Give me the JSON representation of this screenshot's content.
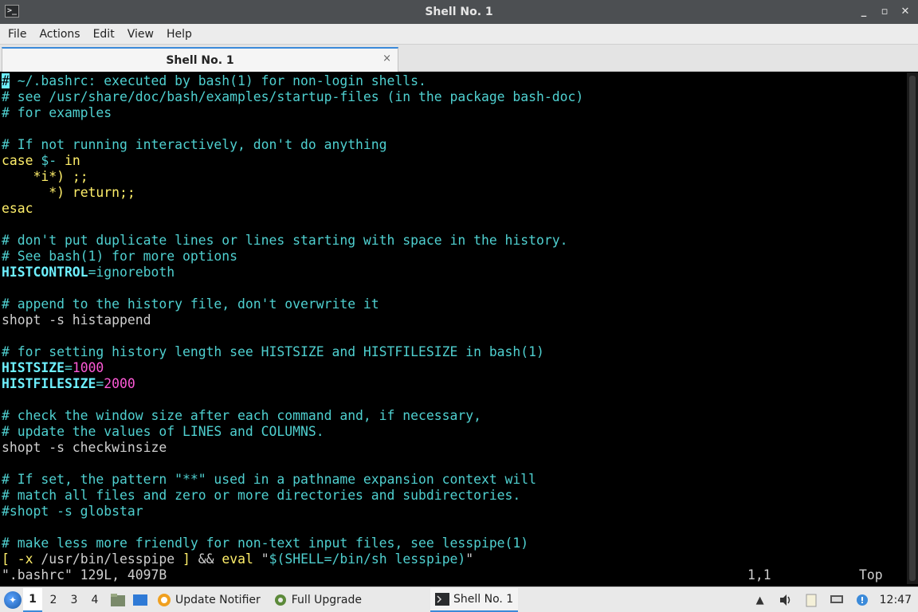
{
  "window": {
    "title": "Shell No. 1",
    "controls": {
      "minimize": "_",
      "maximize": "▫",
      "close": "✕"
    }
  },
  "menu": [
    "File",
    "Actions",
    "Edit",
    "View",
    "Help"
  ],
  "tab": {
    "label": "Shell No. 1",
    "close": "×"
  },
  "terminal": {
    "lines": [
      [
        [
          "cursor",
          "#"
        ],
        [
          "c",
          " ~/.bashrc: executed by bash(1) for non-login shells."
        ]
      ],
      [
        [
          "c",
          "# see /usr/share/doc/bash/examples/startup-files (in the package bash-doc)"
        ]
      ],
      [
        [
          "c",
          "# for examples"
        ]
      ],
      [],
      [
        [
          "c",
          "# If not running interactively, don't do anything"
        ]
      ],
      [
        [
          "k",
          "case"
        ],
        [
          "p",
          " "
        ],
        [
          "c",
          "$-"
        ],
        [
          "p",
          " "
        ],
        [
          "k",
          "in"
        ]
      ],
      [
        [
          "p",
          "    "
        ],
        [
          "k",
          "*i*) ;;"
        ]
      ],
      [
        [
          "p",
          "      "
        ],
        [
          "k",
          "*) return;;"
        ]
      ],
      [
        [
          "k",
          "esac"
        ]
      ],
      [],
      [
        [
          "c",
          "# don't put duplicate lines or lines starting with space in the history."
        ]
      ],
      [
        [
          "c",
          "# See bash(1) for more options"
        ]
      ],
      [
        [
          "v",
          "HISTCONTROL"
        ],
        [
          "c",
          "=ignoreboth"
        ]
      ],
      [],
      [
        [
          "c",
          "# append to the history file, don't overwrite it"
        ]
      ],
      [
        [
          "p",
          "shopt -s histappend"
        ]
      ],
      [],
      [
        [
          "c",
          "# for setting history length see HISTSIZE and HISTFILESIZE in bash(1)"
        ]
      ],
      [
        [
          "v",
          "HISTSIZE"
        ],
        [
          "c",
          "="
        ],
        [
          "n",
          "1000"
        ]
      ],
      [
        [
          "v",
          "HISTFILESIZE"
        ],
        [
          "c",
          "="
        ],
        [
          "n",
          "2000"
        ]
      ],
      [],
      [
        [
          "c",
          "# check the window size after each command and, if necessary,"
        ]
      ],
      [
        [
          "c",
          "# update the values of LINES and COLUMNS."
        ]
      ],
      [
        [
          "p",
          "shopt -s checkwinsize"
        ]
      ],
      [],
      [
        [
          "c",
          "# If set, the pattern \"**\" used in a pathname expansion context will"
        ]
      ],
      [
        [
          "c",
          "# match all files and zero or more directories and subdirectories."
        ]
      ],
      [
        [
          "c",
          "#shopt -s globstar"
        ]
      ],
      [],
      [
        [
          "c",
          "# make less more friendly for non-text input files, see lesspipe(1)"
        ]
      ],
      [
        [
          "k",
          "["
        ],
        [
          "p",
          " "
        ],
        [
          "k",
          "-x"
        ],
        [
          "p",
          " /usr/bin/lesspipe "
        ],
        [
          "k",
          "]"
        ],
        [
          "p",
          " && "
        ],
        [
          "k",
          "eval"
        ],
        [
          "p",
          " \""
        ],
        [
          "c",
          "$(SHELL=/bin/sh lesspipe)"
        ],
        [
          "p",
          "\""
        ]
      ]
    ],
    "status": {
      "file": "\".bashrc\" 129L, 4097B",
      "position": "1,1",
      "scroll": "Top"
    }
  },
  "taskbar": {
    "workspaces": [
      "1",
      "2",
      "3",
      "4"
    ],
    "active_workspace": "1",
    "tasks": [
      {
        "label": "Update Notifier",
        "icon": "update-notifier-icon"
      },
      {
        "label": "Full Upgrade",
        "icon": "gear-icon"
      },
      {
        "label": "Shell No. 1",
        "icon": "terminal-icon"
      }
    ],
    "clock": "12:47"
  }
}
